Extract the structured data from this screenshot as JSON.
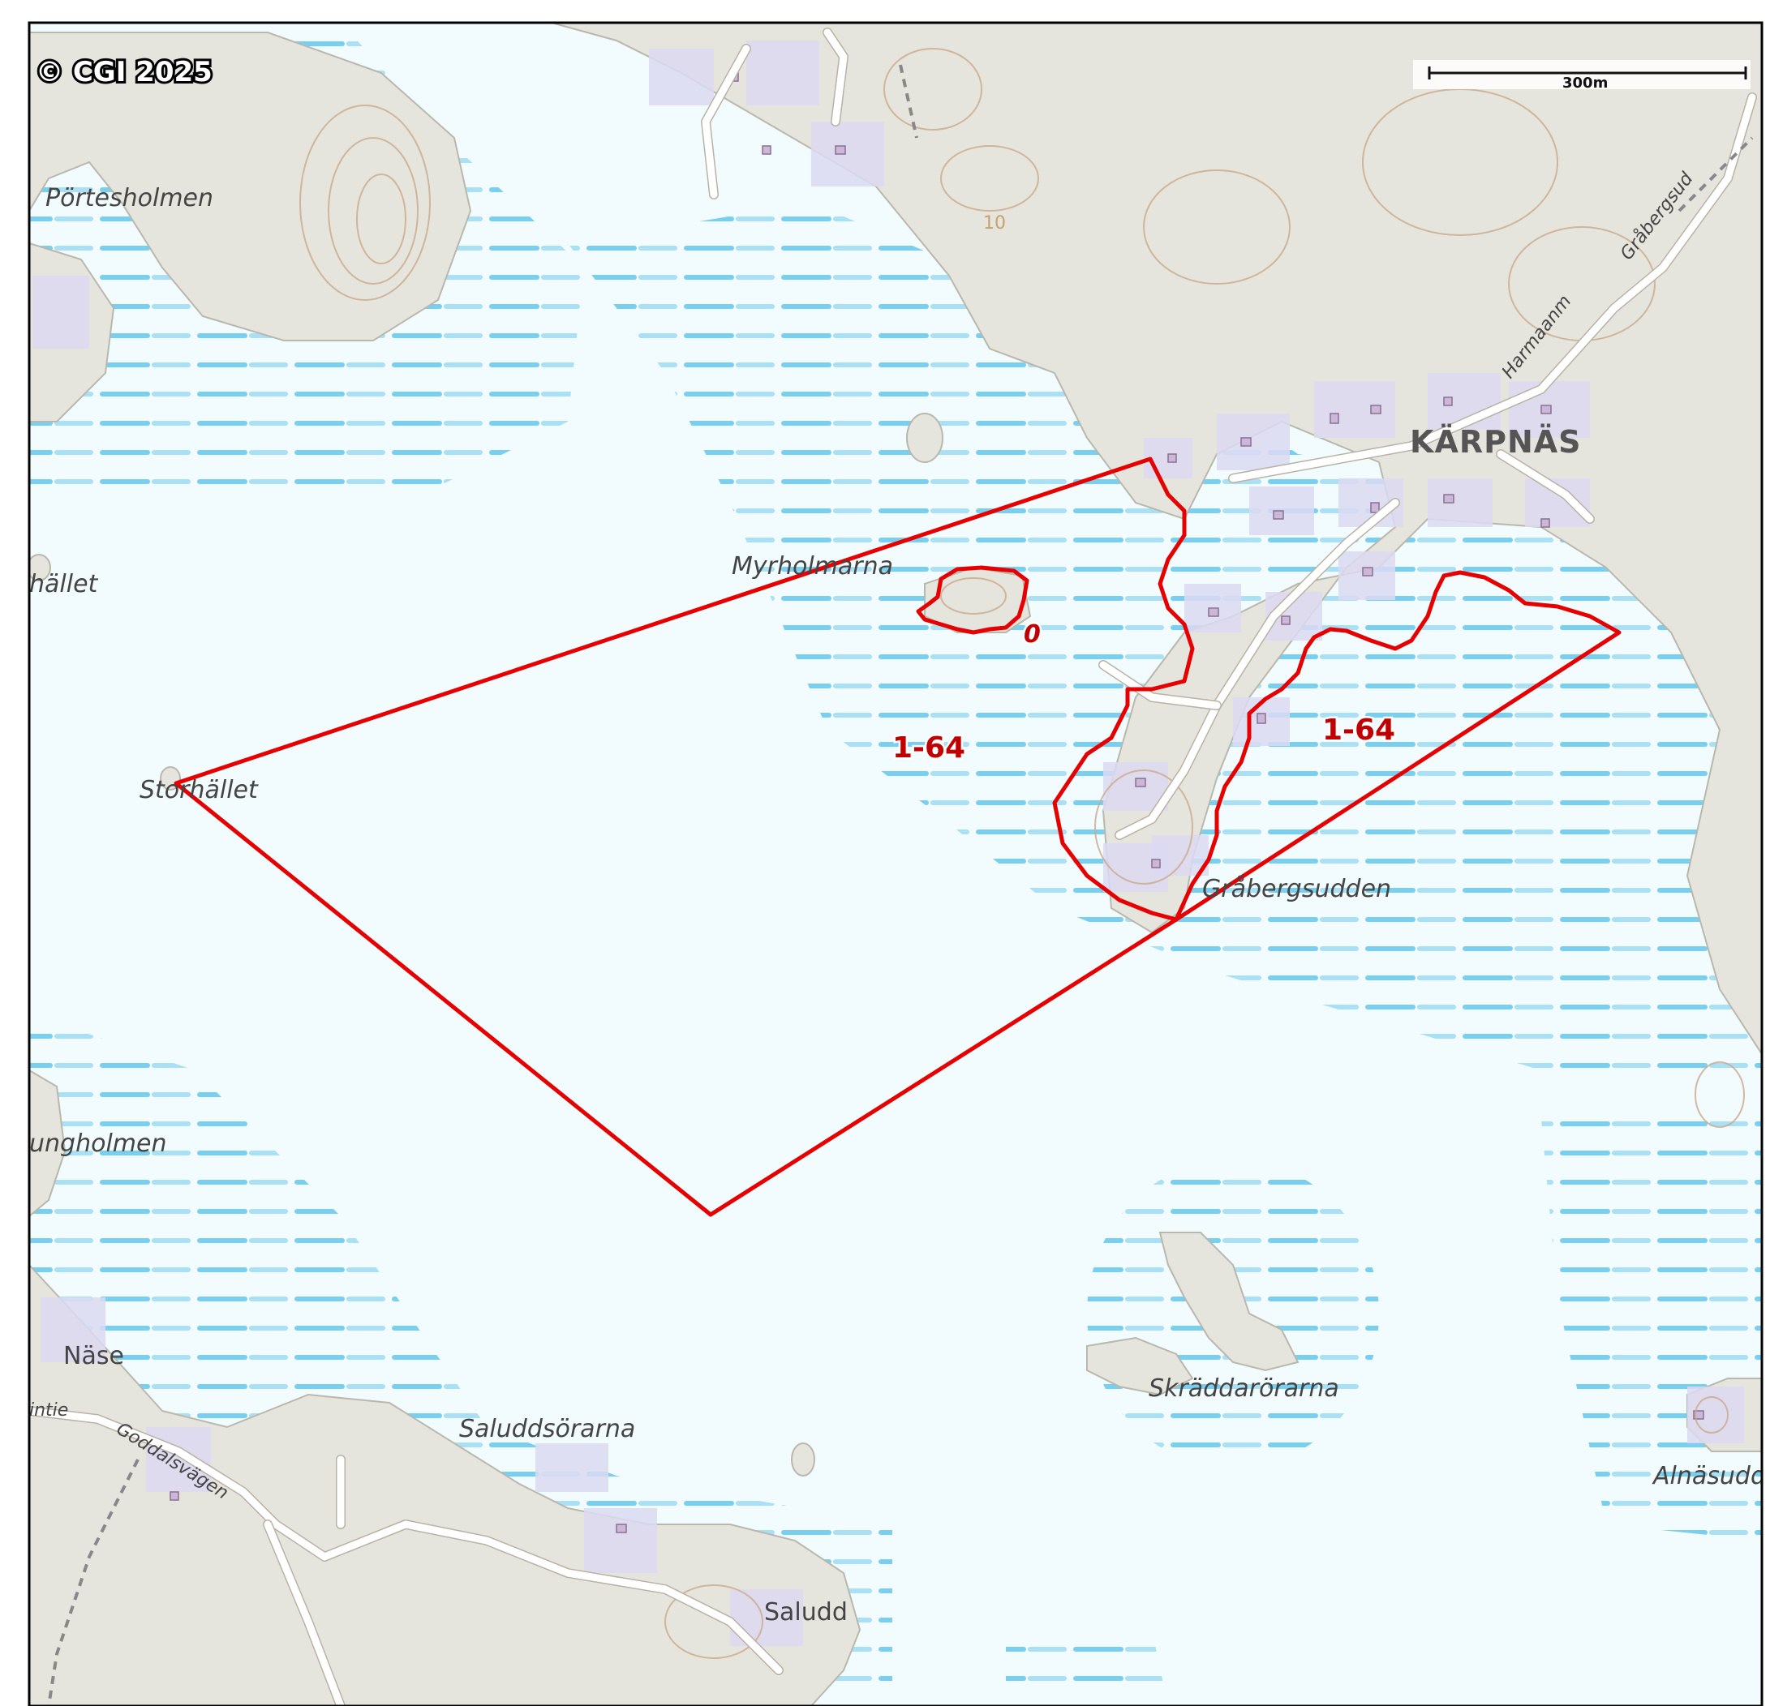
{
  "copyright": "© CGI 2025",
  "scale_bar": {
    "label": "300m"
  },
  "places": {
    "portesholmen": "Pörtesholmen",
    "hallet": "hället",
    "myrholmarna": "Myrholmarna",
    "storhallet": "Storhället",
    "karpnas": "KÄRPNÄS",
    "grabergsudden": "Gråbergsudden",
    "ungholmen": "ungholmen",
    "nase": "Näse",
    "saluddsorarna": "Saluddsörarna",
    "skraddarorarna": "Skräddarörarna",
    "saludd": "Saludd",
    "alnasudd": "Alnäsudd"
  },
  "roads": {
    "grabergsud": "Gråbergsud",
    "harmaa": "Harmaanm",
    "goddals": "Goddalsvägen",
    "intie": "intie"
  },
  "contour_label": "10",
  "parcels": {
    "label_west": "1-64",
    "label_east": "1-64",
    "label_islet": "0"
  },
  "colors": {
    "water": "#f2fbfd",
    "water_dash": "#58c3ec",
    "land": "#e6e5dd",
    "parcel": "#e60000",
    "frame": "#000000"
  }
}
